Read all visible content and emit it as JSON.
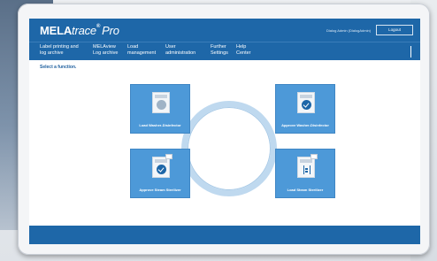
{
  "header": {
    "brand_bold": "MELA",
    "brand_italic": "trace",
    "brand_mark": "®",
    "brand_suffix": "Pro",
    "user_info": "Dialog Admin (DialogAdmin)",
    "logout_label": "Logout"
  },
  "menu": [
    {
      "line1": "Label printing and",
      "line2": "log archive"
    },
    {
      "line1": "MELAview",
      "line2": "Log archive"
    },
    {
      "line1": "Load",
      "line2": "management"
    },
    {
      "line1": "User",
      "line2": "administration"
    },
    {
      "line1": "Further",
      "line2": "Settings"
    },
    {
      "line1": "Help",
      "line2": "Center"
    }
  ],
  "instruction": "Select a function.",
  "tiles": [
    {
      "label": "Load Washer-Disinfector",
      "icon": "washer-disinfector-icon"
    },
    {
      "label": "Approve Washer-Disinfector",
      "icon": "approve-washer-icon"
    },
    {
      "label": "Approve Steam Sterilizer",
      "icon": "approve-sterilizer-icon"
    },
    {
      "label": "Load Steam Sterilizer",
      "icon": "steam-sterilizer-icon"
    }
  ],
  "colors": {
    "primary": "#1e67a8",
    "tile": "#4d99d8",
    "ring": "#bfd9ef"
  }
}
